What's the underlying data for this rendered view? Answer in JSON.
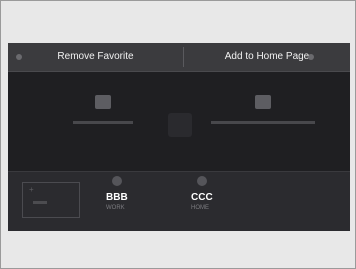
{
  "header": {
    "remove_label": "Remove Favorite",
    "add_label": "Add to Home Page"
  },
  "favorites": [
    {
      "name": "BBB",
      "type": "WORK"
    },
    {
      "name": "CCC",
      "type": "HOME"
    }
  ]
}
